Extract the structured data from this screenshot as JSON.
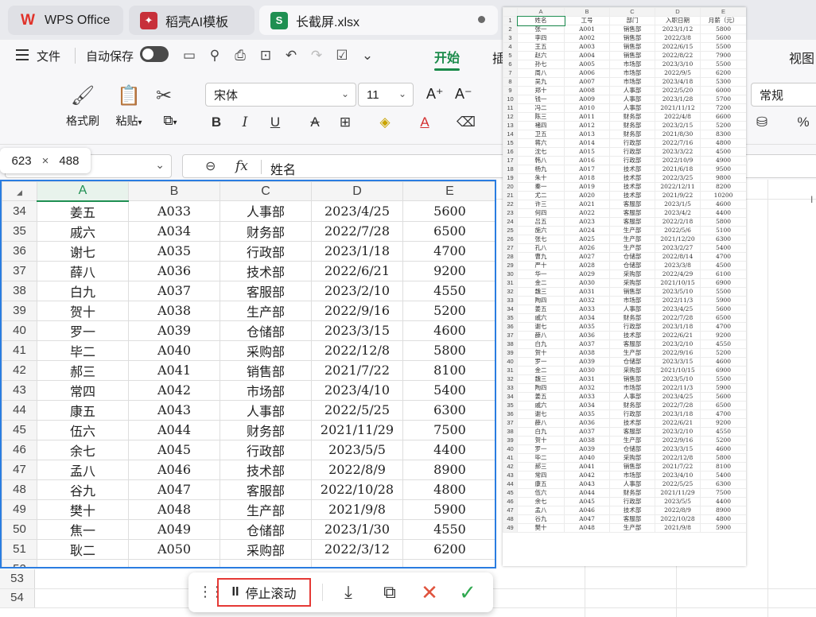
{
  "tabs": [
    {
      "label": "WPS Office",
      "icon": "wps-logo-icon"
    },
    {
      "label": "稻壳AI模板",
      "icon": "docer-icon"
    },
    {
      "label": "长截屏.xlsx",
      "icon": "spreadsheet-icon",
      "icon_letter": "S"
    }
  ],
  "menubar": {
    "file_label": "文件",
    "autosave_label": "自动保存",
    "start_tab": "开始",
    "partial_left": "插",
    "partial_right": "视图"
  },
  "ribbon": {
    "format_painter": "格式刷",
    "paste": "粘贴",
    "font_name": "宋体",
    "font_size": "11",
    "style_name": "常规",
    "percent": "%"
  },
  "formula": {
    "value": "姓名"
  },
  "size_tip": {
    "width": "623",
    "times": "×",
    "height": "488"
  },
  "sheet": {
    "columns": [
      "A",
      "B",
      "C",
      "D",
      "E"
    ],
    "rows": [
      {
        "n": "34",
        "c": [
          "姜五",
          "A033",
          "人事部",
          "2023/4/25",
          "5600"
        ]
      },
      {
        "n": "35",
        "c": [
          "戚六",
          "A034",
          "财务部",
          "2022/7/28",
          "6500"
        ]
      },
      {
        "n": "36",
        "c": [
          "谢七",
          "A035",
          "行政部",
          "2023/1/18",
          "4700"
        ]
      },
      {
        "n": "37",
        "c": [
          "薛八",
          "A036",
          "技术部",
          "2022/6/21",
          "9200"
        ]
      },
      {
        "n": "38",
        "c": [
          "白九",
          "A037",
          "客服部",
          "2023/2/10",
          "4550"
        ]
      },
      {
        "n": "39",
        "c": [
          "贺十",
          "A038",
          "生产部",
          "2022/9/16",
          "5200"
        ]
      },
      {
        "n": "40",
        "c": [
          "罗一",
          "A039",
          "仓储部",
          "2023/3/15",
          "4600"
        ]
      },
      {
        "n": "41",
        "c": [
          "毕二",
          "A040",
          "采购部",
          "2022/12/8",
          "5800"
        ]
      },
      {
        "n": "42",
        "c": [
          "郝三",
          "A041",
          "销售部",
          "2021/7/22",
          "8100"
        ]
      },
      {
        "n": "43",
        "c": [
          "常四",
          "A042",
          "市场部",
          "2023/4/10",
          "5400"
        ]
      },
      {
        "n": "44",
        "c": [
          "康五",
          "A043",
          "人事部",
          "2022/5/25",
          "6300"
        ]
      },
      {
        "n": "45",
        "c": [
          "伍六",
          "A044",
          "财务部",
          "2021/11/29",
          "7500"
        ]
      },
      {
        "n": "46",
        "c": [
          "余七",
          "A045",
          "行政部",
          "2023/5/5",
          "4400"
        ]
      },
      {
        "n": "47",
        "c": [
          "孟八",
          "A046",
          "技术部",
          "2022/8/9",
          "8900"
        ]
      },
      {
        "n": "48",
        "c": [
          "谷九",
          "A047",
          "客服部",
          "2022/10/28",
          "4800"
        ]
      },
      {
        "n": "49",
        "c": [
          "樊十",
          "A048",
          "生产部",
          "2021/9/8",
          "5900"
        ]
      },
      {
        "n": "50",
        "c": [
          "焦一",
          "A049",
          "仓储部",
          "2023/1/30",
          "4550"
        ]
      },
      {
        "n": "51",
        "c": [
          "耿二",
          "A050",
          "采购部",
          "2022/3/12",
          "6200"
        ]
      },
      {
        "n": "52",
        "c": [
          "",
          "",
          "",
          "",
          ""
        ]
      }
    ],
    "extra_rows": [
      "53",
      "54"
    ]
  },
  "preview": {
    "columns": [
      "A",
      "B",
      "C",
      "D",
      "E"
    ],
    "rows": [
      [
        "1",
        "姓名",
        "工号",
        "部门",
        "入职日期",
        "月薪（元）"
      ],
      [
        "2",
        "张一",
        "A001",
        "销售部",
        "2023/1/12",
        "5800"
      ],
      [
        "3",
        "李四",
        "A002",
        "销售部",
        "2022/3/8",
        "5600"
      ],
      [
        "4",
        "王五",
        "A003",
        "销售部",
        "2022/6/15",
        "5500"
      ],
      [
        "5",
        "赵六",
        "A004",
        "销售部",
        "2022/8/22",
        "7900"
      ],
      [
        "6",
        "孙七",
        "A005",
        "市场部",
        "2023/3/10",
        "5500"
      ],
      [
        "7",
        "周八",
        "A006",
        "市场部",
        "2022/9/5",
        "6200"
      ],
      [
        "8",
        "吴九",
        "A007",
        "市场部",
        "2023/4/18",
        "5300"
      ],
      [
        "9",
        "郑十",
        "A008",
        "人事部",
        "2022/5/20",
        "6000"
      ],
      [
        "10",
        "钱一",
        "A009",
        "人事部",
        "2023/1/28",
        "5700"
      ],
      [
        "11",
        "冯二",
        "A010",
        "人事部",
        "2021/11/12",
        "7200"
      ],
      [
        "12",
        "陈三",
        "A011",
        "财务部",
        "2022/4/8",
        "6600"
      ],
      [
        "13",
        "褚四",
        "A012",
        "财务部",
        "2023/2/15",
        "5200"
      ],
      [
        "14",
        "卫五",
        "A013",
        "财务部",
        "2021/8/30",
        "8300"
      ],
      [
        "15",
        "蒋六",
        "A014",
        "行政部",
        "2022/7/16",
        "4800"
      ],
      [
        "16",
        "沈七",
        "A015",
        "行政部",
        "2023/3/22",
        "4500"
      ],
      [
        "17",
        "韩八",
        "A016",
        "行政部",
        "2022/10/9",
        "4900"
      ],
      [
        "18",
        "杨九",
        "A017",
        "技术部",
        "2021/6/18",
        "9500"
      ],
      [
        "19",
        "朱十",
        "A018",
        "技术部",
        "2022/3/25",
        "9800"
      ],
      [
        "20",
        "秦一",
        "A019",
        "技术部",
        "2022/12/11",
        "8200"
      ],
      [
        "21",
        "尤二",
        "A020",
        "技术部",
        "2021/9/22",
        "10200"
      ],
      [
        "22",
        "许三",
        "A021",
        "客服部",
        "2023/1/5",
        "4600"
      ],
      [
        "23",
        "何四",
        "A022",
        "客服部",
        "2023/4/2",
        "4400"
      ],
      [
        "24",
        "吕五",
        "A023",
        "客服部",
        "2022/2/18",
        "5800"
      ],
      [
        "25",
        "施六",
        "A024",
        "生产部",
        "2022/5/6",
        "5100"
      ],
      [
        "26",
        "张七",
        "A025",
        "生产部",
        "2021/12/20",
        "6300"
      ],
      [
        "27",
        "孔八",
        "A026",
        "生产部",
        "2023/2/27",
        "5400"
      ],
      [
        "28",
        "曹九",
        "A027",
        "仓储部",
        "2022/8/14",
        "4700"
      ],
      [
        "29",
        "严十",
        "A028",
        "仓储部",
        "2023/3/8",
        "4500"
      ],
      [
        "30",
        "华一",
        "A029",
        "采购部",
        "2022/4/29",
        "6100"
      ],
      [
        "31",
        "金二",
        "A030",
        "采购部",
        "2021/10/15",
        "6900"
      ],
      [
        "32",
        "魏三",
        "A031",
        "销售部",
        "2023/5/10",
        "5500"
      ],
      [
        "33",
        "陶四",
        "A032",
        "市场部",
        "2022/11/3",
        "5900"
      ],
      [
        "34",
        "姜五",
        "A033",
        "人事部",
        "2023/4/25",
        "5600"
      ],
      [
        "35",
        "戚六",
        "A034",
        "财务部",
        "2022/7/28",
        "6500"
      ],
      [
        "36",
        "谢七",
        "A035",
        "行政部",
        "2023/1/18",
        "4700"
      ],
      [
        "37",
        "薛八",
        "A036",
        "技术部",
        "2022/6/21",
        "9200"
      ],
      [
        "38",
        "白九",
        "A037",
        "客服部",
        "2023/2/10",
        "4550"
      ],
      [
        "39",
        "贺十",
        "A038",
        "生产部",
        "2022/9/16",
        "5200"
      ],
      [
        "40",
        "罗一",
        "A039",
        "仓储部",
        "2023/3/15",
        "4600"
      ],
      [
        "31",
        "金二",
        "A030",
        "采购部",
        "2021/10/15",
        "6900"
      ],
      [
        "32",
        "魏三",
        "A031",
        "销售部",
        "2023/5/10",
        "5500"
      ],
      [
        "33",
        "陶四",
        "A032",
        "市场部",
        "2022/11/3",
        "5900"
      ],
      [
        "34",
        "姜五",
        "A033",
        "人事部",
        "2023/4/25",
        "5600"
      ],
      [
        "35",
        "戚六",
        "A034",
        "财务部",
        "2022/7/28",
        "6500"
      ],
      [
        "36",
        "谢七",
        "A035",
        "行政部",
        "2023/1/18",
        "4700"
      ],
      [
        "37",
        "薛八",
        "A036",
        "技术部",
        "2022/6/21",
        "9200"
      ],
      [
        "38",
        "白九",
        "A037",
        "客服部",
        "2023/2/10",
        "4550"
      ],
      [
        "39",
        "贺十",
        "A038",
        "生产部",
        "2022/9/16",
        "5200"
      ],
      [
        "40",
        "罗一",
        "A039",
        "仓储部",
        "2023/3/15",
        "4600"
      ],
      [
        "41",
        "毕二",
        "A040",
        "采购部",
        "2022/12/8",
        "5800"
      ],
      [
        "42",
        "郝三",
        "A041",
        "销售部",
        "2021/7/22",
        "8100"
      ],
      [
        "43",
        "常四",
        "A042",
        "市场部",
        "2023/4/10",
        "5400"
      ],
      [
        "44",
        "康五",
        "A043",
        "人事部",
        "2022/5/25",
        "6300"
      ],
      [
        "45",
        "伍六",
        "A044",
        "财务部",
        "2021/11/29",
        "7500"
      ],
      [
        "46",
        "余七",
        "A045",
        "行政部",
        "2023/5/5",
        "4400"
      ],
      [
        "47",
        "孟八",
        "A046",
        "技术部",
        "2022/8/9",
        "8900"
      ],
      [
        "48",
        "谷九",
        "A047",
        "客服部",
        "2022/10/28",
        "4800"
      ],
      [
        "49",
        "樊十",
        "A048",
        "生产部",
        "2021/9/8",
        "5900"
      ]
    ]
  },
  "toolbar": {
    "stop_label": "停止滚动",
    "pause_glyph": "II"
  }
}
